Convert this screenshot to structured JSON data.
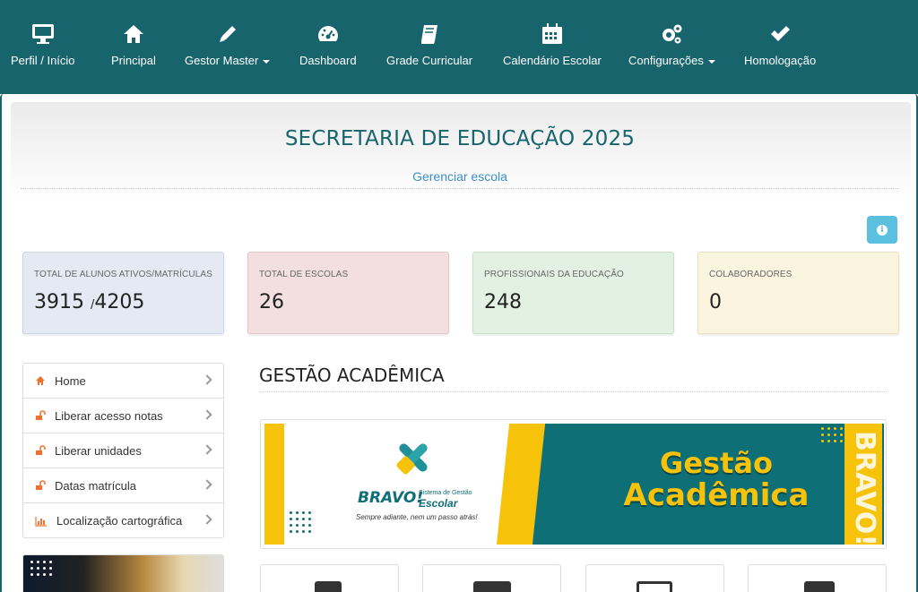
{
  "nav": {
    "items": [
      {
        "label": "Perfil / Início",
        "icon": "monitor-icon",
        "has_caret": false
      },
      {
        "label": "Principal",
        "icon": "home-icon",
        "has_caret": false
      },
      {
        "label": "Gestor Master",
        "icon": "pencil-icon",
        "has_caret": true
      },
      {
        "label": "Dashboard",
        "icon": "dashboard-icon",
        "has_caret": false
      },
      {
        "label": "Grade Curricular",
        "icon": "book-icon",
        "has_caret": false
      },
      {
        "label": "Calendário Escolar",
        "icon": "calendar-icon",
        "has_caret": false
      },
      {
        "label": "Configurações",
        "icon": "gears-icon",
        "has_caret": true
      },
      {
        "label": "Homologação",
        "icon": "check-icon",
        "has_caret": false
      }
    ]
  },
  "header": {
    "title": "SECRETARIA DE EDUCAÇÃO 2025",
    "manage_link": "Gerenciar escola"
  },
  "stats": [
    {
      "label": "TOTAL DE ALUNOS ATIVOS/MATRÍCULAS",
      "value": "3915",
      "value_suffix": "/",
      "value_total": "4205",
      "bg": "#e4e9f4",
      "border": "#cdd6ea"
    },
    {
      "label": "TOTAL DE ESCOLAS",
      "value": "26",
      "bg": "#f3dfe0",
      "border": "#e6c6c8"
    },
    {
      "label": "PROFISSIONAIS DA EDUCAÇÃO",
      "value": "248",
      "bg": "#e3f1e2",
      "border": "#c8e2c6"
    },
    {
      "label": "COLABORADORES",
      "value": "0",
      "bg": "#fbf5e0",
      "border": "#ece1bd"
    }
  ],
  "side_menu": {
    "items": [
      {
        "label": "Home",
        "icon": "home-icon"
      },
      {
        "label": "Liberar acesso notas",
        "icon": "unlock-icon"
      },
      {
        "label": "Liberar unidades",
        "icon": "unlock-icon"
      },
      {
        "label": "Datas matrícula",
        "icon": "unlock-icon"
      },
      {
        "label": "Localização cartográfica",
        "icon": "bar-chart-icon"
      }
    ]
  },
  "section": {
    "title": "GESTÃO ACADÊMICA"
  },
  "banner": {
    "brand": "BRAVO!",
    "brand_sub": "Sistema de Gestão",
    "brand_product": "Escolar",
    "tagline": "Sempre adiante, nem um passo atrás!",
    "headline_line1": "Gestão",
    "headline_line2": "Acadêmica",
    "vertical_text": "BRAVO!"
  },
  "colors": {
    "nav_bg": "#17646c",
    "accent_orange": "#f0712b",
    "info": "#5bc0de",
    "link": "#3d8ec9",
    "banner_yellow": "#f6c20a",
    "banner_teal": "#0f6f77"
  }
}
